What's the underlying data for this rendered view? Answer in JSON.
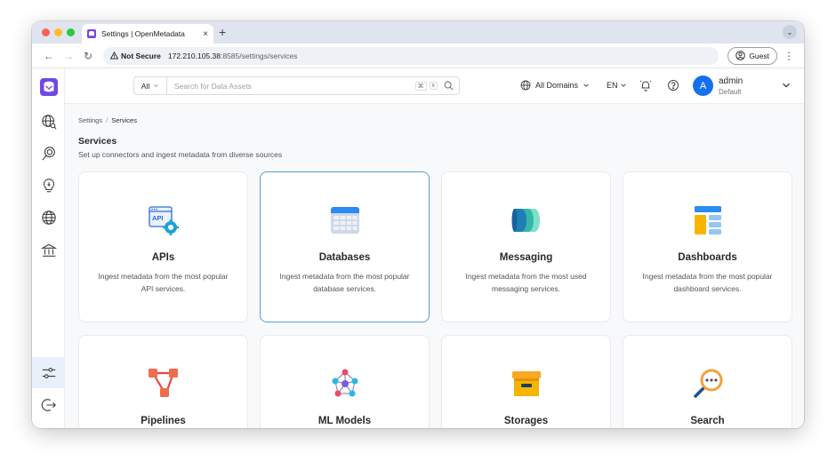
{
  "browser": {
    "tab_title": "Settings | OpenMetadata",
    "tab_close": "×",
    "new_tab": "+",
    "security_label": "Not Secure",
    "url_host": "172.210.105.38",
    "url_path": ":8585/settings/services",
    "profile_label": "Guest"
  },
  "header": {
    "search_filter": "All",
    "search_placeholder": "Search for Data Assets",
    "shortcut_cmd": "⌘",
    "shortcut_x": "x",
    "domains_label": "All Domains",
    "language": "EN",
    "user_initial": "A",
    "user_name": "admin",
    "user_role": "Default"
  },
  "breadcrumb": {
    "root": "Settings",
    "separator": "/",
    "current": "Services"
  },
  "page": {
    "title": "Services",
    "subtitle": "Set up connectors and ingest metadata from diverse sources"
  },
  "cards": [
    {
      "title": "APIs",
      "desc": "Ingest metadata from the most popular API services.",
      "icon": "api-icon"
    },
    {
      "title": "Databases",
      "desc": "Ingest metadata from the most popular database services.",
      "icon": "database-icon"
    },
    {
      "title": "Messaging",
      "desc": "Ingest metadata from the most used messaging services.",
      "icon": "messaging-icon"
    },
    {
      "title": "Dashboards",
      "desc": "Ingest metadata from the most popular dashboard services.",
      "icon": "dashboard-icon"
    },
    {
      "title": "Pipelines",
      "icon": "pipeline-icon"
    },
    {
      "title": "ML Models",
      "icon": "ml-model-icon"
    },
    {
      "title": "Storages",
      "icon": "storage-icon"
    },
    {
      "title": "Search",
      "icon": "search-service-icon"
    }
  ],
  "colors": {
    "accent": "#1570ef",
    "selected_border": "#5a9bd8"
  }
}
